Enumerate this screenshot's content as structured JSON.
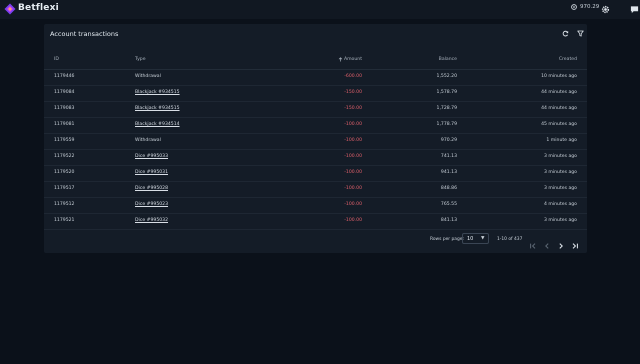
{
  "header": {
    "brand": "Betflexi",
    "balance": "970.29"
  },
  "card": {
    "title": "Account transactions",
    "columns": {
      "id": "ID",
      "type": "Type",
      "amount": "Amount",
      "balance": "Balance",
      "created": "Created"
    }
  },
  "rows": [
    {
      "id": "1179446",
      "type": "Withdrawal",
      "link": false,
      "amount": "-600.00",
      "balance": "1,552.20",
      "created": "10 minutes ago"
    },
    {
      "id": "1179084",
      "type": "Blackjack #934515",
      "link": true,
      "amount": "-150.00",
      "balance": "1,578.79",
      "created": "44 minutes ago"
    },
    {
      "id": "1179083",
      "type": "Blackjack #934515",
      "link": true,
      "amount": "-150.00",
      "balance": "1,728.79",
      "created": "44 minutes ago"
    },
    {
      "id": "1179081",
      "type": "Blackjack #934514",
      "link": true,
      "amount": "-100.00",
      "balance": "1,778.79",
      "created": "45 minutes ago"
    },
    {
      "id": "1179559",
      "type": "Withdrawal",
      "link": false,
      "amount": "-100.00",
      "balance": "970.29",
      "created": "1 minute ago"
    },
    {
      "id": "1179522",
      "type": "Dice #995033",
      "link": true,
      "amount": "-100.00",
      "balance": "741.13",
      "created": "3 minutes ago"
    },
    {
      "id": "1179520",
      "type": "Dice #995031",
      "link": true,
      "amount": "-100.00",
      "balance": "941.13",
      "created": "3 minutes ago"
    },
    {
      "id": "1179517",
      "type": "Dice #995028",
      "link": true,
      "amount": "-100.00",
      "balance": "848.86",
      "created": "3 minutes ago"
    },
    {
      "id": "1179512",
      "type": "Dice #995023",
      "link": true,
      "amount": "-100.00",
      "balance": "765.55",
      "created": "4 minutes ago"
    },
    {
      "id": "1179521",
      "type": "Dice #995032",
      "link": true,
      "amount": "-100.00",
      "balance": "841.13",
      "created": "3 minutes ago"
    }
  ],
  "pagination": {
    "rows_per_page_label": "Rows per page:",
    "rows_per_page_value": "10",
    "range": "1-10 of 437"
  },
  "colors": {
    "accent": "#7b3ff2",
    "negative": "#e0606b",
    "background": "#0b111a",
    "card": "#141c27"
  }
}
